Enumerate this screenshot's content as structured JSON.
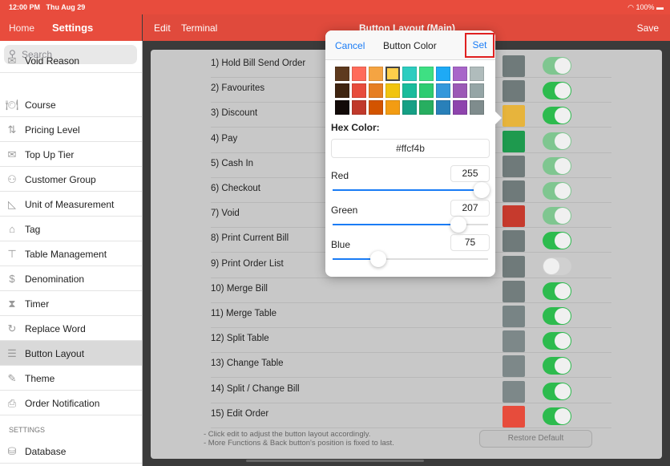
{
  "status": {
    "time": "12:00 PM",
    "date": "Thu Aug 29",
    "battery": "100%"
  },
  "nav": {
    "home": "Home",
    "settings": "Settings",
    "edit": "Edit",
    "terminal": "Terminal",
    "title": "Button Layout (Main)",
    "save": "Save"
  },
  "sidebar": {
    "search_placeholder": "Search",
    "items": [
      {
        "label": "Void Reason",
        "icon": "✉"
      },
      {
        "label": "Course",
        "icon": "🍽"
      },
      {
        "label": "Pricing Level",
        "icon": "⇅"
      },
      {
        "label": "Top Up Tier",
        "icon": "✉"
      },
      {
        "label": "Customer Group",
        "icon": "⚇"
      },
      {
        "label": "Unit of Measurement",
        "icon": "◺"
      },
      {
        "label": "Tag",
        "icon": "⌂"
      },
      {
        "label": "Table Management",
        "icon": "⊤"
      },
      {
        "label": "Denomination",
        "icon": "$"
      },
      {
        "label": "Timer",
        "icon": "⧗"
      },
      {
        "label": "Replace Word",
        "icon": "↻"
      },
      {
        "label": "Button Layout",
        "icon": "☰"
      },
      {
        "label": "Theme",
        "icon": "✎"
      },
      {
        "label": "Order Notification",
        "icon": "⎙"
      }
    ],
    "section": "SETTINGS",
    "section_items": [
      {
        "label": "Database",
        "icon": "⛁"
      }
    ],
    "active": "Button Layout"
  },
  "rows": [
    {
      "label": "1) Hold Bill Send Order",
      "color": "#6f7a7a",
      "toggle": "dim"
    },
    {
      "label": "2) Favourites",
      "color": "#6f7a7a",
      "toggle": "on"
    },
    {
      "label": "3) Discount",
      "color": "#e7b43c",
      "toggle": "on"
    },
    {
      "label": "4) Pay",
      "color": "#1e9a4e",
      "toggle": "dim"
    },
    {
      "label": "5) Cash In",
      "color": "#6f7a7a",
      "toggle": "dim"
    },
    {
      "label": "6) Checkout",
      "color": "#6f7a7a",
      "toggle": "dim"
    },
    {
      "label": "7) Void",
      "color": "#c63a2d",
      "toggle": "dim"
    },
    {
      "label": "8) Print Current Bill",
      "color": "#6f7a7a",
      "toggle": "on"
    },
    {
      "label": "9) Print Order List",
      "color": "#6f7a7a",
      "toggle": "off"
    },
    {
      "label": "10) Merge Bill",
      "color": "#727d7d",
      "toggle": "on"
    },
    {
      "label": "11) Merge Table",
      "color": "#788485",
      "toggle": "on"
    },
    {
      "label": "12) Split Table",
      "color": "#7d8889",
      "toggle": "on"
    },
    {
      "label": "13) Change Table",
      "color": "#7d8889",
      "toggle": "on"
    },
    {
      "label": "14) Split / Change Bill",
      "color": "#7d8889",
      "toggle": "on"
    },
    {
      "label": "15) Edit Order",
      "color": "#e74c3c",
      "toggle": "on"
    }
  ],
  "notes": [
    "- Click edit to adjust the button layout accordingly.",
    "- More Functions & Back button's position is fixed to last."
  ],
  "restore": "Restore Default",
  "popover": {
    "cancel": "Cancel",
    "title": "Button Color",
    "set": "Set",
    "hex_label": "Hex Color:",
    "hex": "#ffcf4b",
    "swatches": [
      "#5e3a1e",
      "#ff6b5b",
      "#f5a442",
      "#ffcf4b",
      "#2dcdc0",
      "#3ee083",
      "#1eaaf5",
      "#a865c9",
      "#b0bcbc",
      "#3f2410",
      "#e74c3c",
      "#e67e22",
      "#f1c40f",
      "#1abc9c",
      "#2ecc71",
      "#3498db",
      "#9b59b6",
      "#95a5a6",
      "#120a08",
      "#c0392b",
      "#d35400",
      "#f39c12",
      "#16a085",
      "#27ae60",
      "#2980b9",
      "#8e44ad",
      "#7f8c8d"
    ],
    "selected": "#ffcf4b",
    "channels": [
      {
        "label": "Red",
        "value": "255"
      },
      {
        "label": "Green",
        "value": "207"
      },
      {
        "label": "Blue",
        "value": "75"
      }
    ]
  }
}
